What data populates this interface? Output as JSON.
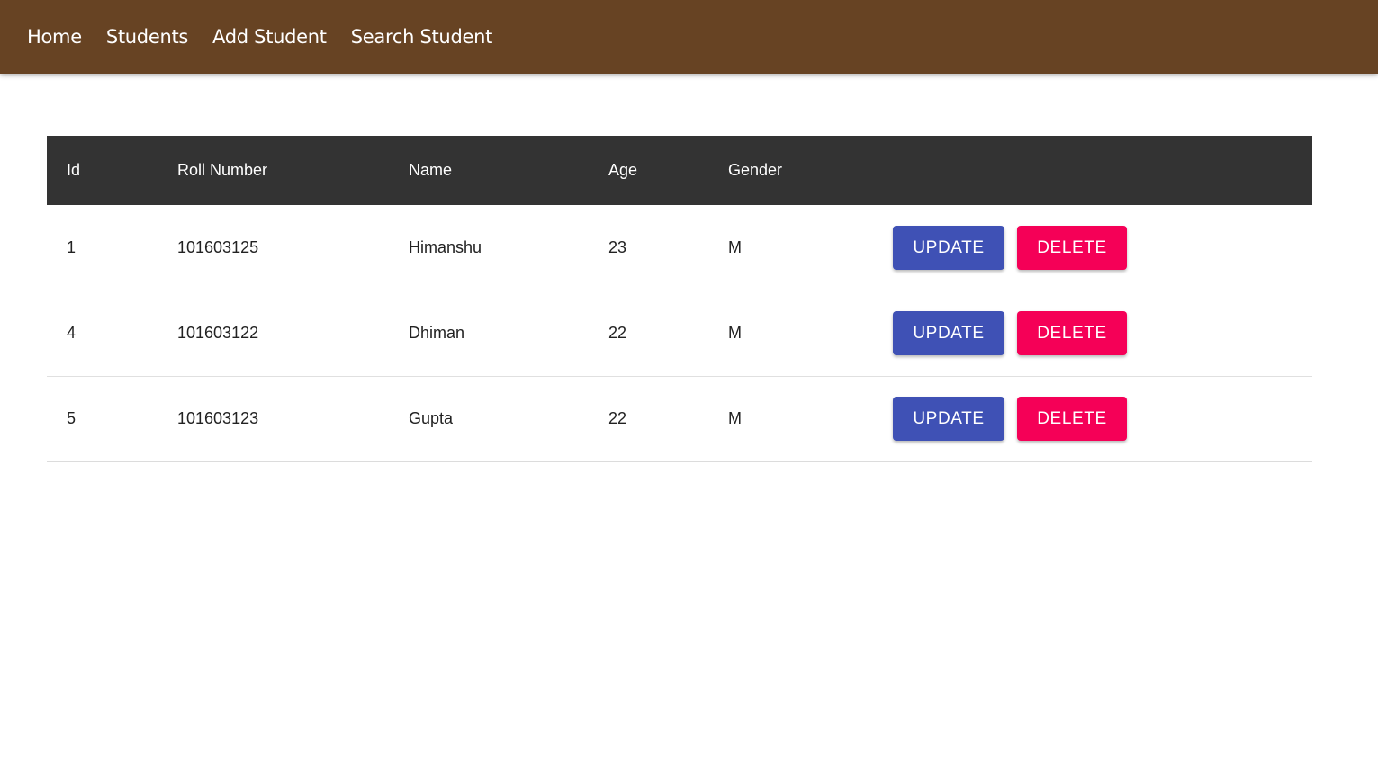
{
  "nav": {
    "items": [
      {
        "label": "Home"
      },
      {
        "label": "Students"
      },
      {
        "label": "Add Student"
      },
      {
        "label": "Search Student"
      }
    ]
  },
  "table": {
    "headers": {
      "id": "Id",
      "roll": "Roll Number",
      "name": "Name",
      "age": "Age",
      "gender": "Gender"
    },
    "rows": [
      {
        "id": "1",
        "roll": "101603125",
        "name": "Himanshu",
        "age": "23",
        "gender": "M",
        "update_label": "UPDATE",
        "delete_label": "DELETE"
      },
      {
        "id": "4",
        "roll": "101603122",
        "name": "Dhiman",
        "age": "22",
        "gender": "M",
        "update_label": "UPDATE",
        "delete_label": "DELETE"
      },
      {
        "id": "5",
        "roll": "101603123",
        "name": "Gupta",
        "age": "22",
        "gender": "M",
        "update_label": "UPDATE",
        "delete_label": "DELETE"
      }
    ]
  },
  "colors": {
    "navbar": "#674323",
    "table_header": "#333333",
    "update_button": "#3f51b5",
    "delete_button": "#f50057"
  }
}
